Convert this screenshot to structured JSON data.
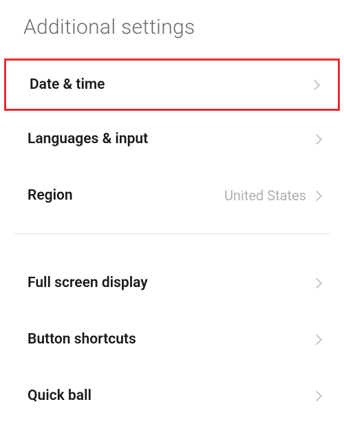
{
  "title": "Additional settings",
  "items": [
    {
      "label": "Date & time",
      "value": null,
      "highlighted": true
    },
    {
      "label": "Languages & input",
      "value": null,
      "highlighted": false
    },
    {
      "label": "Region",
      "value": "United States",
      "highlighted": false
    }
  ],
  "items2": [
    {
      "label": "Full screen display",
      "value": null
    },
    {
      "label": "Button shortcuts",
      "value": null
    },
    {
      "label": "Quick ball",
      "value": null
    }
  ]
}
